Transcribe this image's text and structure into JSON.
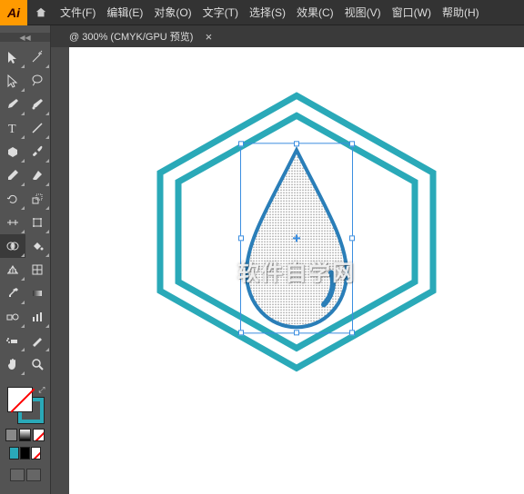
{
  "app": {
    "logo": "Ai"
  },
  "menu": [
    {
      "label": "文件(F)"
    },
    {
      "label": "编辑(E)"
    },
    {
      "label": "对象(O)"
    },
    {
      "label": "文字(T)"
    },
    {
      "label": "选择(S)"
    },
    {
      "label": "效果(C)"
    },
    {
      "label": "视图(V)"
    },
    {
      "label": "窗口(W)"
    },
    {
      "label": "帮助(H)"
    }
  ],
  "doc": {
    "tab_label": "@ 300% (CMYK/GPU 预览)",
    "close": "×"
  },
  "tools_left": [
    "selection",
    "direct-selection",
    "pen",
    "type",
    "line",
    "rectangle",
    "paintbrush",
    "rotate",
    "width",
    "shape-builder",
    "perspective",
    "mesh",
    "eyedropper",
    "symbol-sprayer",
    "column-graph",
    "artboard",
    "hand"
  ],
  "tools_right": [
    "magic-wand",
    "lasso",
    "curvature",
    "touch-type",
    "arc",
    "ellipse",
    "blob-brush",
    "scale",
    "warp",
    "live-paint",
    "perspective-selection",
    "gradient",
    "measure",
    "scissors",
    "slice",
    "print-tiling",
    "zoom"
  ],
  "colors": {
    "stroke": "#2aa9b8",
    "fill": "none",
    "swatches": [
      "#2aa9b8",
      "#000000",
      "none"
    ]
  },
  "watermark": "软件自学网"
}
